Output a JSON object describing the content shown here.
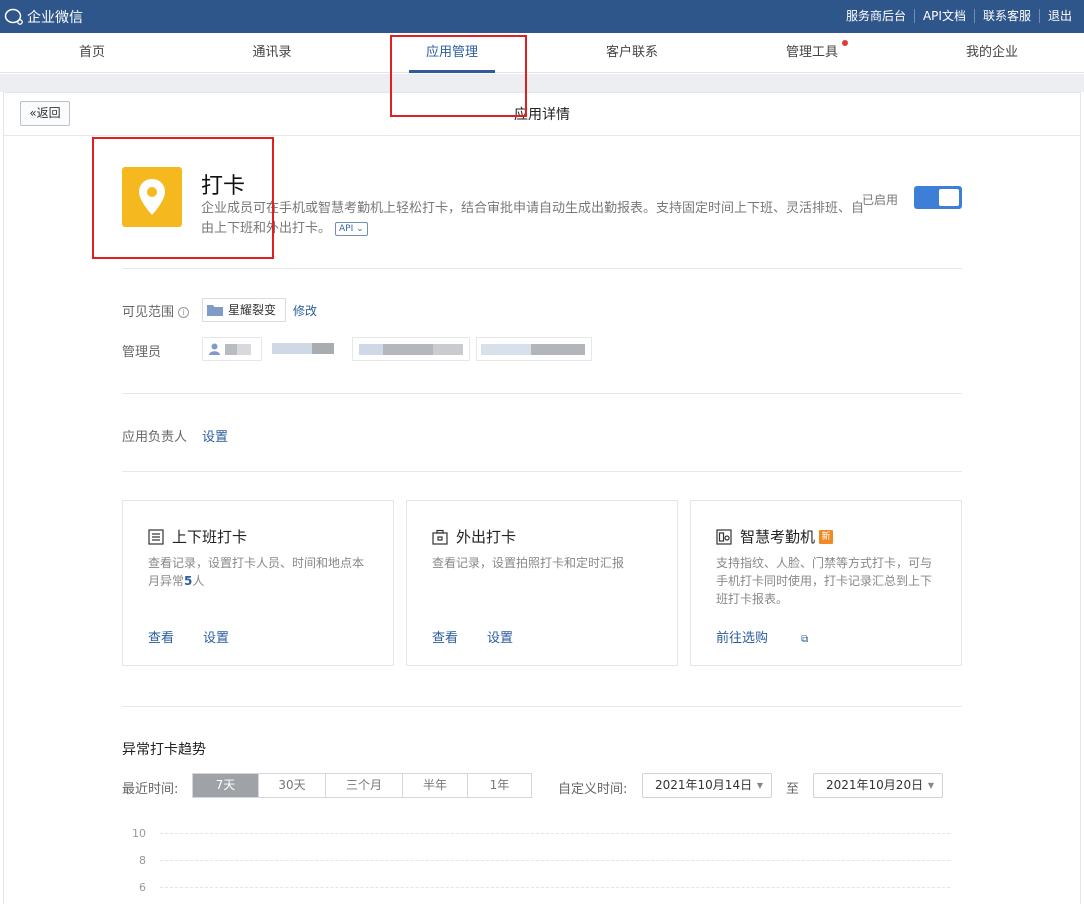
{
  "topbar": {
    "brand": "企业微信",
    "links": [
      "服务商后台",
      "API文档",
      "联系客服",
      "退出"
    ]
  },
  "nav": {
    "items": [
      "首页",
      "通讯录",
      "应用管理",
      "客户联系",
      "管理工具",
      "我的企业"
    ],
    "active_index": 2
  },
  "header": {
    "back_label": "返回",
    "title": "应用详情"
  },
  "app": {
    "name": "打卡",
    "description": "企业成员可在手机或智慧考勤机上轻松打卡，结合审批申请自动生成出勤报表。支持固定时间上下班、灵活排班、自由上下班和外出打卡。",
    "api_tag": "API",
    "status_label": "已启用",
    "enabled": true,
    "icon": "location-pin-icon",
    "icon_color": "#f5b81e"
  },
  "visibility": {
    "label": "可见范围",
    "department": "星耀裂变",
    "edit_label": "修改"
  },
  "admins": {
    "label": "管理员"
  },
  "owner": {
    "label": "应用负责人",
    "set_label": "设置"
  },
  "features": [
    {
      "title": "上下班打卡",
      "icon": "list-icon",
      "desc_prefix": "查看记录，设置打卡人员、时间和地点本月异常",
      "desc_count": "5",
      "desc_suffix": "人",
      "links": [
        "查看",
        "设置"
      ]
    },
    {
      "title": "外出打卡",
      "icon": "briefcase-icon",
      "desc": "查看记录，设置拍照打卡和定时汇报",
      "links": [
        "查看",
        "设置"
      ]
    },
    {
      "title": "智慧考勤机",
      "icon": "device-icon",
      "badge": "新",
      "desc": "支持指纹、人脸、门禁等方式打卡，可与手机打卡同时使用，打卡记录汇总到上下班打卡报表。",
      "links": [
        "前往选购"
      ]
    }
  ],
  "trend": {
    "title": "异常打卡趋势",
    "period_label": "最近时间:",
    "periods": [
      "7天",
      "30天",
      "三个月",
      "半年",
      "1年"
    ],
    "selected_period": "7天",
    "custom_label": "自定义时间:",
    "start_date": "2021年10月14日",
    "to_label": "至",
    "end_date": "2021年10月20日"
  },
  "chart_data": {
    "type": "line",
    "title": "异常打卡趋势",
    "y_ticks": [
      "10",
      "8",
      "6"
    ],
    "series": []
  }
}
